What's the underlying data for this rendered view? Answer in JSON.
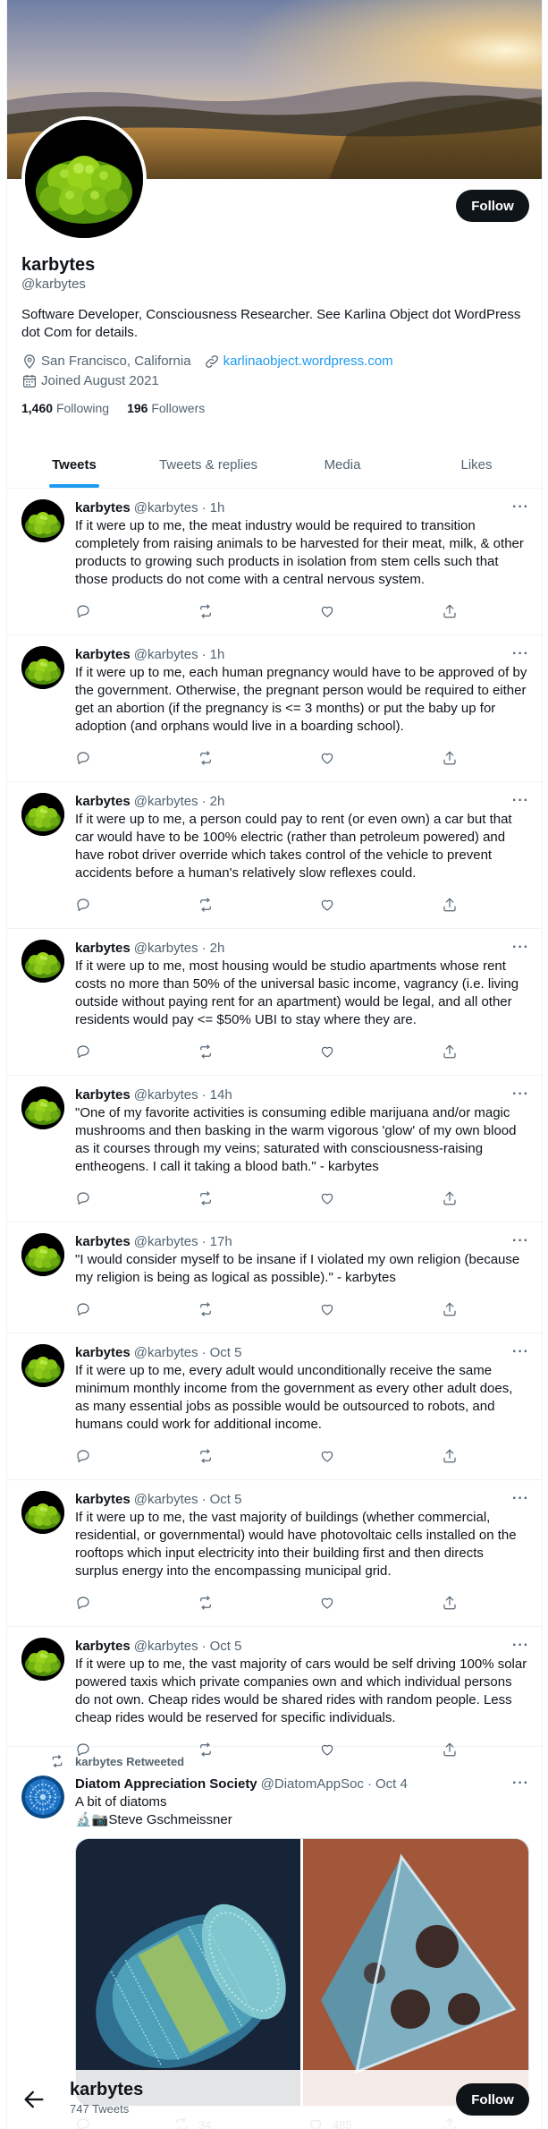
{
  "profile": {
    "display_name": "karbytes",
    "handle": "@karbytes",
    "bio": "Software Developer, Consciousness Researcher. See Karlina Object dot WordPress dot Com for details.",
    "location": "San Francisco, California",
    "website": "karlinaobject.wordpress.com",
    "joined": "Joined August 2021",
    "following_count": "1,460",
    "following_label": "Following",
    "followers_count": "196",
    "followers_label": "Followers",
    "follow_label": "Follow",
    "tweet_count": "747 Tweets"
  },
  "tabs": [
    "Tweets",
    "Tweets & replies",
    "Media",
    "Likes"
  ],
  "tweets": [
    {
      "name": "karbytes",
      "handle": "@karbytes",
      "time": "1h",
      "text": "If it were up to me, the meat industry would be required to transition completely from raising animals to be harvested for their meat, milk, & other products to growing such products in isolation from stem cells such that those products do not come with a central nervous system."
    },
    {
      "name": "karbytes",
      "handle": "@karbytes",
      "time": "1h",
      "text": "If it were up to me, each human pregnancy would have to be approved of by the government. Otherwise, the pregnant person would be required to either get an abortion (if the pregnancy is <= 3 months) or put the baby up for adoption (and orphans would live in a boarding school)."
    },
    {
      "name": "karbytes",
      "handle": "@karbytes",
      "time": "2h",
      "text": "If it were up to me, a person could pay to rent (or even own) a car but that car would have to be 100% electric (rather than petroleum powered) and have robot driver override which takes control of the vehicle to prevent accidents before a human's relatively slow reflexes could."
    },
    {
      "name": "karbytes",
      "handle": "@karbytes",
      "time": "2h",
      "text": "If it were up to me, most housing would be studio apartments whose rent costs no more than 50% of the universal basic income, vagrancy (i.e. living outside without paying rent for an apartment) would be legal, and all other residents would pay <= $50% UBI to stay where they are."
    },
    {
      "name": "karbytes",
      "handle": "@karbytes",
      "time": "14h",
      "text": "\"One of my favorite activities is consuming edible marijuana and/or magic mushrooms and then basking in the warm vigorous 'glow' of my own blood as it courses through my veins; saturated with consciousness-raising entheogens. I call it taking a blood bath.\" - karbytes"
    },
    {
      "name": "karbytes",
      "handle": "@karbytes",
      "time": "17h",
      "text": "\"I would consider myself to be insane if I violated my own religion (because my religion is being as logical as possible).\" - karbytes"
    },
    {
      "name": "karbytes",
      "handle": "@karbytes",
      "time": "Oct 5",
      "text": "If it were up to me, every adult would unconditionally receive the same minimum monthly income from the government as every other adult does, as many essential jobs as possible would be outsourced to robots, and humans could work for additional income."
    },
    {
      "name": "karbytes",
      "handle": "@karbytes",
      "time": "Oct 5",
      "text": "If it were up to me, the vast majority of buildings (whether commercial, residential, or governmental) would have photovoltaic cells installed on the rooftops which input electricity into their building first and then directs surplus energy into the encompassing municipal grid."
    },
    {
      "name": "karbytes",
      "handle": "@karbytes",
      "time": "Oct 5",
      "text": "If it were up to me, the vast majority of cars would be self driving 100% solar powered taxis which private companies own and which individual persons do not own. Cheap rides would be shared rides with random people. Less cheap rides would be reserved for specific individuals."
    }
  ],
  "retweet": {
    "retweeted_by": "karbytes Retweeted",
    "name": "Diatom Appreciation Society",
    "handle": "@DiatomAppSoc",
    "time": "Oct 4",
    "text": "A bit of diatoms",
    "credit": "🔬📷Steve Gschmeissner",
    "retweets": "34",
    "likes": "485"
  },
  "separator": "·",
  "more_glyph": "···",
  "icons": [
    "location-icon",
    "link-icon",
    "calendar-icon",
    "reply-icon",
    "retweet-icon",
    "like-icon",
    "share-icon",
    "back-arrow-icon"
  ],
  "colors": {
    "accent": "#1d9bf0",
    "text": "#0f1419",
    "muted": "#536471",
    "border": "#eff3f4"
  }
}
